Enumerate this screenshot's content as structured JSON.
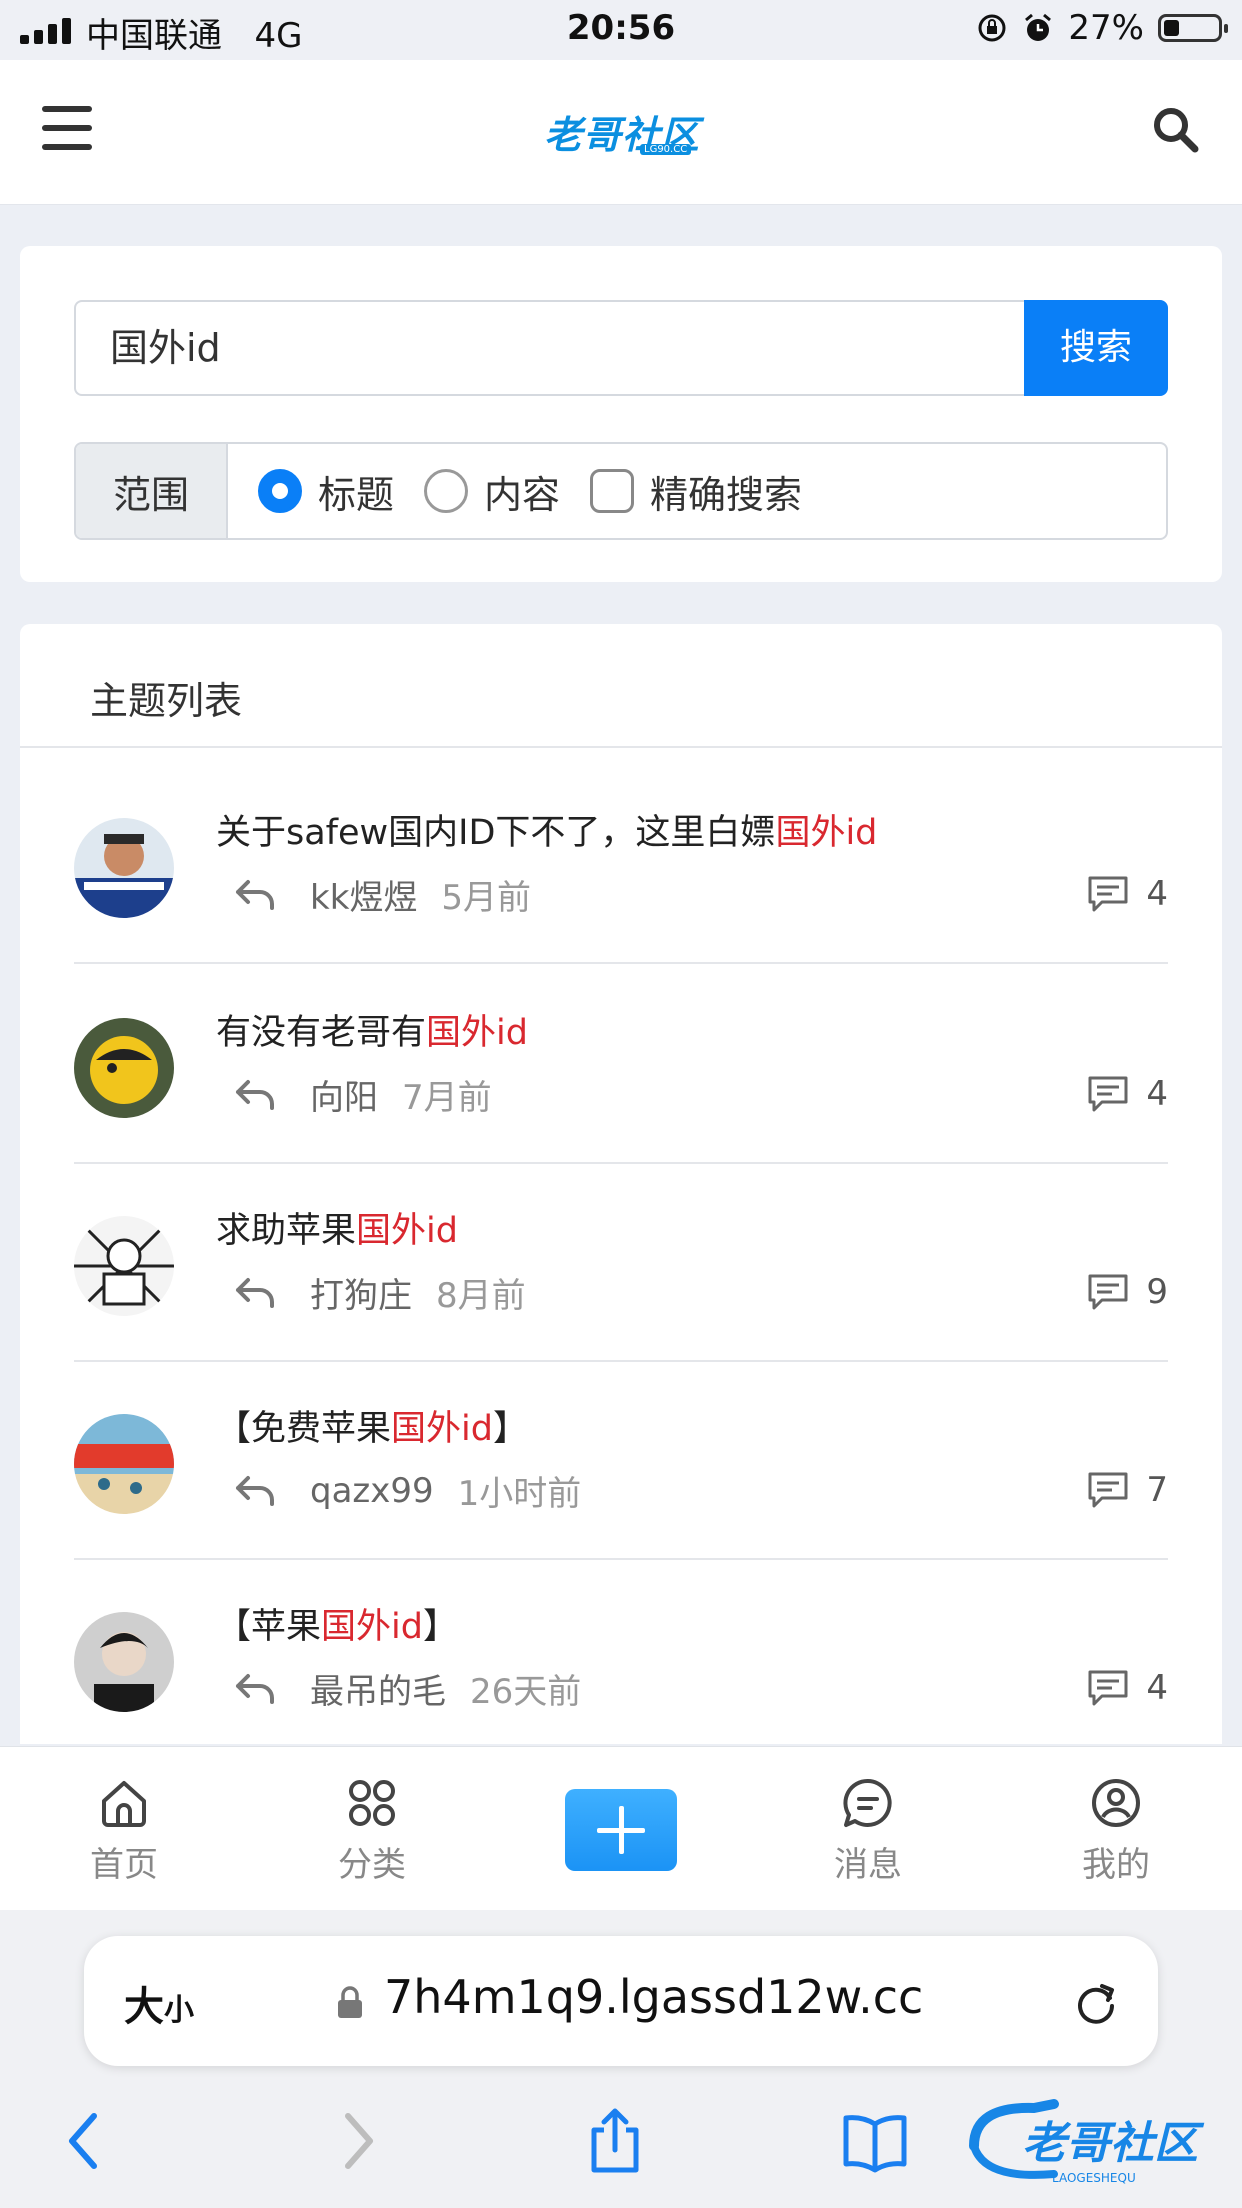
{
  "status_bar": {
    "carrier": "中国联通",
    "network": "4G",
    "time": "20:56",
    "battery": "27%"
  },
  "header": {
    "logo_text": "老哥社区",
    "logo_sub": "LG90.CC"
  },
  "search": {
    "query": "国外id",
    "button_label": "搜索"
  },
  "range": {
    "label": "范围",
    "options": [
      {
        "label": "标题",
        "selected": true
      },
      {
        "label": "内容",
        "selected": false
      }
    ],
    "exact_label": "精确搜索"
  },
  "list": {
    "title": "主题列表",
    "items": [
      {
        "title_prefix": "关于safew国内ID下不了，这里白嫖",
        "highlight": "国外id",
        "title_suffix": "",
        "author": "kk煜煜",
        "ago": "5月前",
        "comments": "4"
      },
      {
        "title_prefix": "有没有老哥有",
        "highlight": "国外id",
        "title_suffix": "",
        "author": "向阳",
        "ago": "7月前",
        "comments": "4"
      },
      {
        "title_prefix": "求助苹果",
        "highlight": "国外id",
        "title_suffix": "",
        "author": "打狗庄",
        "ago": "8月前",
        "comments": "9"
      },
      {
        "title_prefix": "【免费苹果",
        "highlight": "国外id",
        "title_suffix": "】",
        "author": "qazx99",
        "ago": "1小时前",
        "comments": "7"
      },
      {
        "title_prefix": "【苹果",
        "highlight": "国外id",
        "title_suffix": "】",
        "author": "最吊的毛",
        "ago": "26天前",
        "comments": "4"
      }
    ]
  },
  "tabbar": {
    "home": "首页",
    "category": "分类",
    "messages": "消息",
    "mine": "我的"
  },
  "browser": {
    "size_label_big": "大",
    "size_label_small": "小",
    "url": "7h4m1q9.lgassd12w.cc"
  },
  "watermark": {
    "text": "老哥社区",
    "sub": "LAOGESHEQU"
  },
  "colors": {
    "accent": "#0a7ff7",
    "highlight": "#d9282f"
  }
}
